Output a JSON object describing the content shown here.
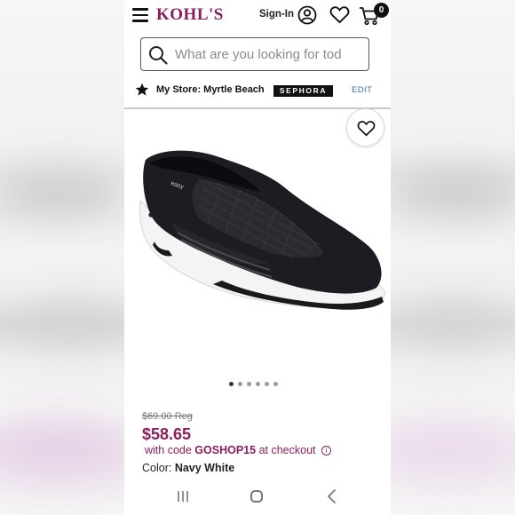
{
  "header": {
    "logo": "KOHL'S",
    "sign_in": "Sign-In",
    "cart_count": "0"
  },
  "search": {
    "placeholder": "What are you looking for tod"
  },
  "store": {
    "label": "My Store: Myrtle Beach",
    "brand_badge": "SEPHORA",
    "edit": "EDIT"
  },
  "gallery": {
    "image_count": 6,
    "active_index": 0
  },
  "product": {
    "regular_price": "$69.00 Reg",
    "sale_price": "$58.65",
    "promo_prefix": "with code",
    "promo_code": "GOSHOP15",
    "promo_suffix": "at checkout",
    "color_label": "Color:",
    "color_value": "Navy White"
  },
  "icons": {
    "menu": "menu-icon",
    "account": "user-icon",
    "wishlist": "heart-icon",
    "cart": "cart-icon",
    "search": "search-icon",
    "store": "star-icon",
    "info": "info-icon",
    "nav_recents": "recents-icon",
    "nav_home": "home-icon",
    "nav_back": "back-icon"
  },
  "colors": {
    "brand": "#8a1d5f",
    "link": "#3a6aa8",
    "text": "#222222"
  }
}
